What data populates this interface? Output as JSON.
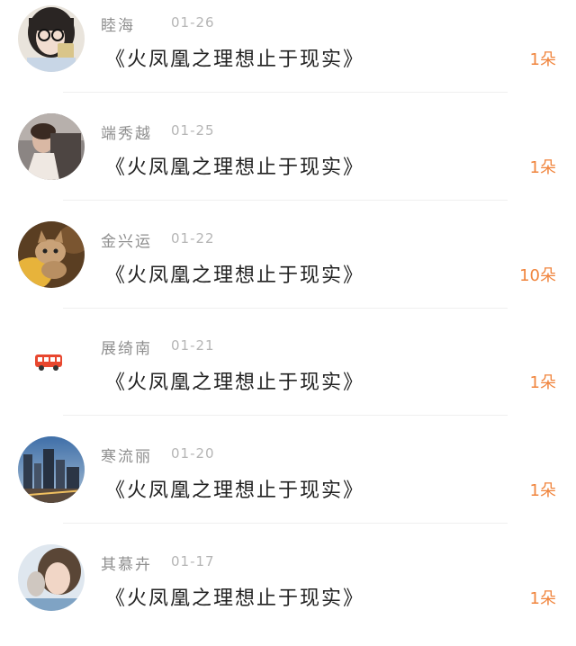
{
  "colors": {
    "accent": "#f0843c",
    "name_text": "#8f8f8f",
    "date_text": "#b5b5b5",
    "title_text": "#222222"
  },
  "items": [
    {
      "name": "睦海",
      "date": "01-26",
      "title": "《火凤凰之理想止于现实》",
      "count": "1朵",
      "avatar": "girl-glasses-avatar"
    },
    {
      "name": "端秀越",
      "date": "01-25",
      "title": "《火凤凰之理想止于现实》",
      "count": "1朵",
      "avatar": "couple-photo-avatar"
    },
    {
      "name": "金兴运",
      "date": "01-22",
      "title": "《火凤凰之理想止于现实》",
      "count": "10朵",
      "avatar": "kitten-avatar"
    },
    {
      "name": "展绮南",
      "date": "01-21",
      "title": "《火凤凰之理想止于现实》",
      "count": "1朵",
      "avatar": "bus-icon"
    },
    {
      "name": "寒流丽",
      "date": "01-20",
      "title": "《火凤凰之理想止于现实》",
      "count": "1朵",
      "avatar": "city-night-avatar"
    },
    {
      "name": "其慕卉",
      "date": "01-17",
      "title": "《火凤凰之理想止于现实》",
      "count": "1朵",
      "avatar": "girl-portrait-avatar"
    }
  ]
}
